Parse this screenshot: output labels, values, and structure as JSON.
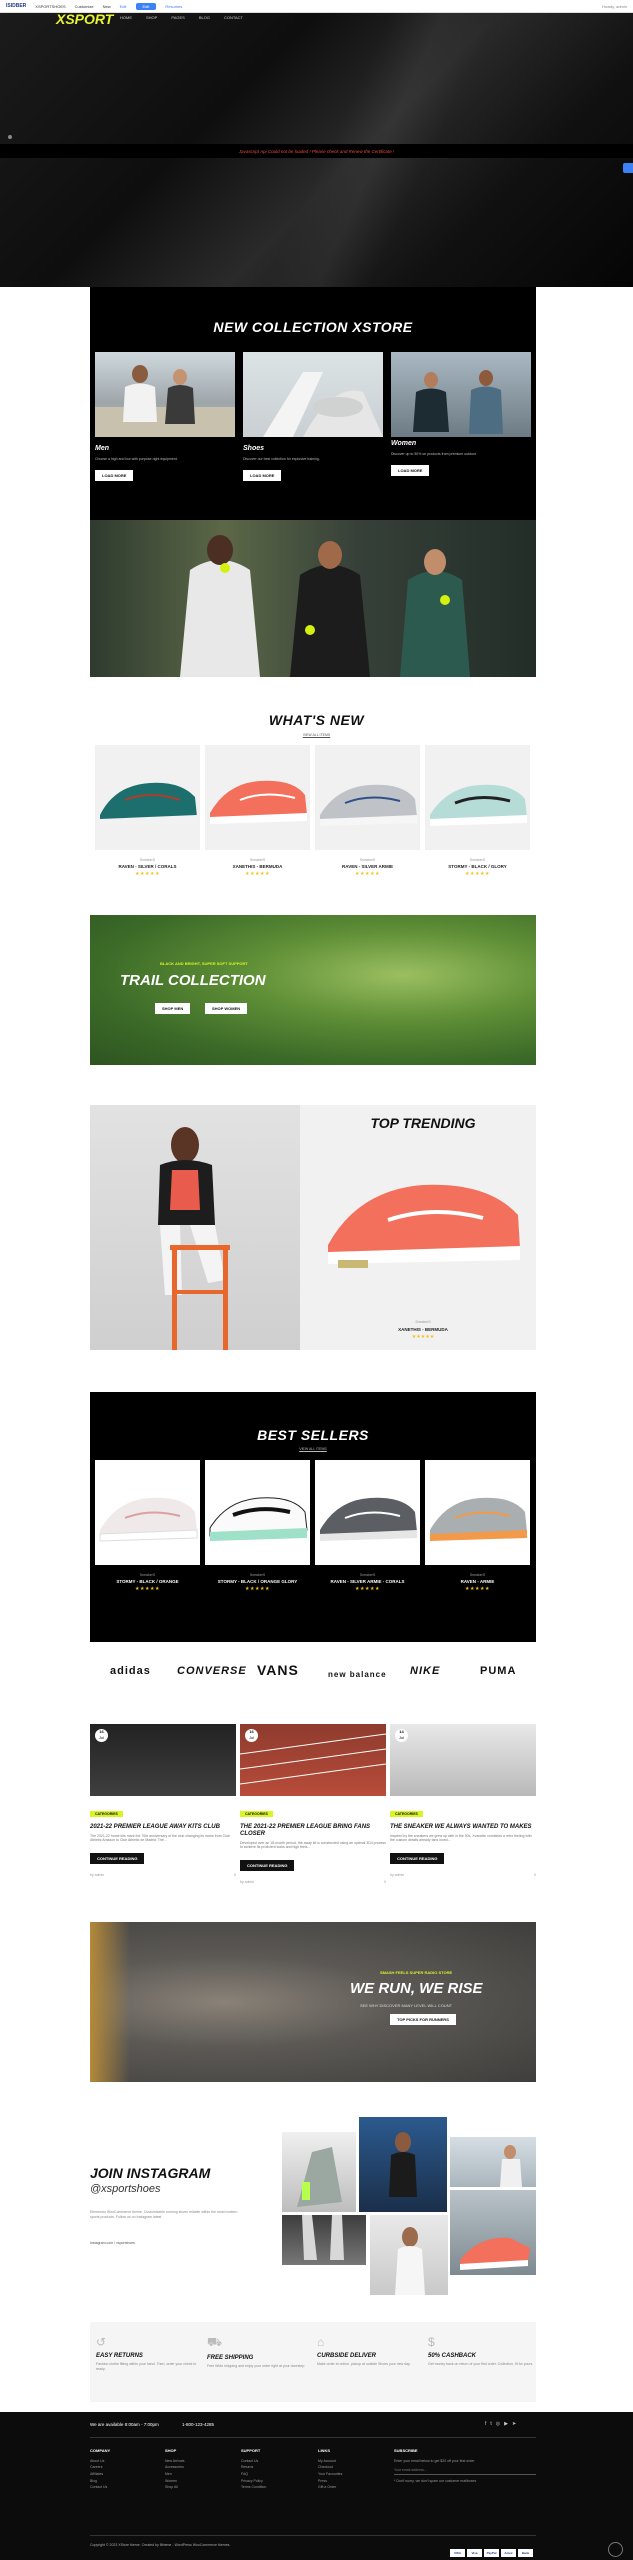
{
  "adminbar": {
    "logo": "ISIDBER",
    "site": "XSPORTSHOES",
    "items": [
      "Customize",
      "New",
      "Edit",
      "Resumes"
    ],
    "cta": "Edit",
    "right": "Howdy, admin"
  },
  "hero": {
    "brand": "XSPORT",
    "nav": [
      "HOME",
      "SHOP",
      "PAGES",
      "BLOG",
      "CONTACT"
    ],
    "alert": "Javascript Api Could not be loaded ! Please check and Renew the Certificate !"
  },
  "new_collection": {
    "title": "NEW COLLECTION XSTORE",
    "cards": [
      {
        "name": "Men",
        "desc": "Choose a high and low with purpose-right equipment.",
        "button": "LOAD MORE"
      },
      {
        "name": "Shoes",
        "desc": "Discover our best collection for explosive training.",
        "button": "LOAD MORE"
      },
      {
        "name": "Women",
        "desc": "Discover up to 50% on products from premium outdoor.",
        "button": "LOAD MORE"
      }
    ]
  },
  "whats_new": {
    "title": "WHAT'S NEW",
    "link": "VIEW ALL ITEMS",
    "products": [
      {
        "brand": "SneakerS",
        "name": "RAVEN - SILVER / CORALS",
        "stars": "★★★★★"
      },
      {
        "brand": "SneakerS",
        "name": "XANETHIS - BERMUDA",
        "stars": "★★★★★"
      },
      {
        "brand": "SneakerS",
        "name": "RAVEN - SILVER ARMIE",
        "stars": "★★★★★"
      },
      {
        "brand": "SneakerS",
        "name": "STORMY - BLACK / GLORY",
        "stars": "★★★★★"
      }
    ]
  },
  "trail": {
    "eyebrow": "BLACK AND BRIGHT, SUPER SOFT SUPPORT",
    "title": "TRAIL COLLECTION",
    "btn1": "SHOP MEN",
    "btn2": "SHOP WOMEN"
  },
  "trending": {
    "title": "TOP TRENDING",
    "brand": "SneakerS",
    "name": "XANETHIS - BERMUDA",
    "stars": "★★★★★"
  },
  "best_sellers": {
    "title": "BEST SELLERS",
    "link": "VIEW ALL ITEMS",
    "products": [
      {
        "brand": "SneakerS",
        "name": "STORMY - BLACK / ORANGE",
        "stars": "★★★★★"
      },
      {
        "brand": "SneakerS",
        "name": "STORMY - BLACK / ORANGE GLORY",
        "stars": "★★★★★"
      },
      {
        "brand": "SneakerS",
        "name": "RAVEN - SILVER ARMIE - CORALS",
        "stars": "★★★★★"
      },
      {
        "brand": "SneakerS",
        "name": "RAVEN - ARMIE",
        "stars": "★★★★★"
      }
    ]
  },
  "brands": [
    "adidas",
    "CONVERSE",
    "VANS",
    "new balance",
    "NIKE",
    "PUMA"
  ],
  "blog": [
    {
      "day": "16",
      "month": "Jul",
      "tag": "CATEGORIES",
      "title": "2021-22 PREMIER LEAGUE AWAY KITS CLUB",
      "excerpt": "The 2021-22 home kits mark the 70th anniversary of the club changing its name from Club Athletic Amazon to Club Athletic de Madrid. The...",
      "button": "CONTINUE READING",
      "author": "by admin",
      "comments": "0"
    },
    {
      "day": "16",
      "month": "Jul",
      "tag": "CATEGORIES",
      "title": "THE 2021-22 PREMIER LEAGUE BRING FANS CLOSER",
      "excerpt": "Developed over an 18-month period, the away kit is constructed using an optimal 3D4 process to achieve its proficient looks and high feels...",
      "button": "CONTINUE READING",
      "author": "by admin",
      "comments": "0"
    },
    {
      "day": "14",
      "month": "Jul",
      "tag": "CATEGORIES",
      "title": "THE SNEAKER WE ALWAYS WANTED TO MAKES",
      "excerpt": "Inspired by the sneakers we grew up with in the 90s, Xvanette combines a retro feeling with the custom details already fans loved...",
      "button": "CONTINUE READING",
      "author": "by admin",
      "comments": "0"
    }
  ],
  "we_run": {
    "eyebrow": "SMASH FEELS SUPER RADIO STORE",
    "title": "WE RUN, WE RISE",
    "sub": "SEE WHY DISCOVER MANY LEVEL WILL COUNT",
    "button": "TOP PICKS FOR RUNNERS"
  },
  "instagram": {
    "title": "JOIN INSTAGRAM",
    "handle": "@xsportshoes",
    "desc": "Elementor WooCommerce theme. Customizable running shoes reliable within the most modern sports products. Follow us on Instagram latest",
    "tag": "Instagram.com / xsportshoes"
  },
  "features": [
    {
      "title": "EASY RETURNS",
      "desc": "Fashion clothe fitting within your hand. Then, order your check to ready.",
      "icon": "↺"
    },
    {
      "title": "FREE SHIPPING",
      "desc": "Free Wide shipping and enjoy your order right at your doorstep.",
      "icon": "⛟"
    },
    {
      "title": "CURBSIDE DELIVER",
      "desc": "Make order at online, pickup at outside Shoes your new day.",
      "icon": "⌂"
    },
    {
      "title": "50% CASHBACK",
      "desc": "Get money back on return of your first order. Collection, fit for yours.",
      "icon": "$"
    }
  ],
  "footer": {
    "available": "We are available 8:00am - 7:00pm",
    "phone": "1-800-123-4285",
    "cols": [
      {
        "title": "COMPANY",
        "links": [
          "About Us",
          "Careers",
          "Affiliates",
          "Blog",
          "Contact Us"
        ]
      },
      {
        "title": "SHOP",
        "links": [
          "New Arrivals",
          "Accessories",
          "Men",
          "Women",
          "Shop All"
        ]
      },
      {
        "title": "SUPPORT",
        "links": [
          "Contact Us",
          "Returns",
          "FAQ",
          "Privacy Policy",
          "Terms Condition"
        ]
      },
      {
        "title": "LINKS",
        "links": [
          "My Account",
          "Checkout",
          "Your Favourites",
          "Press",
          "Gift a Order"
        ]
      }
    ],
    "subscribe_title": "SUBSCRIBE",
    "subscribe_text": "Enter your email below to get $20 off your first order",
    "subscribe_placeholder": "Your email address...",
    "subscribe_note": "* Don't worry, we don't spam our customer mailboxes",
    "copyright": "Copyright © 2023 XStore theme. Created by 8theme - WordPress WooCommerce themes.",
    "payments": [
      "VISA",
      "Visa",
      "PayPal",
      "Amex",
      "Bank"
    ]
  }
}
